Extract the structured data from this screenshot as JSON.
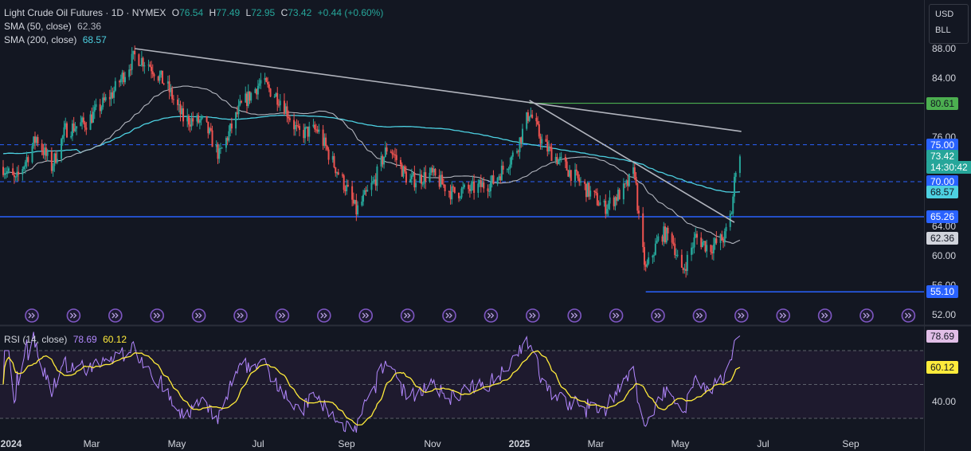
{
  "header": {
    "symbol": "Light Crude Oil Futures · 1D · NYMEX",
    "o_label": "O",
    "o_value": "76.54",
    "h_label": "H",
    "h_value": "77.49",
    "l_label": "L",
    "l_value": "72.95",
    "c_label": "C",
    "c_value": "73.42",
    "change": "+0.44 (+0.60%)",
    "sma50_label": "SMA (50, close)",
    "sma50_value": "62.36",
    "sma200_label": "SMA (200, close)",
    "sma200_value": "68.57",
    "rsi_label": "RSI (14, close)",
    "rsi_value": "78.69",
    "rsi_ma_value": "60.12"
  },
  "unit_box": {
    "currency": "USD",
    "unit": "BLL"
  },
  "price_tags": [
    {
      "text": "80.61",
      "price": 80.61,
      "bg": "#4caf50",
      "fg": "#131722"
    },
    {
      "text": "75.00",
      "price": 75.0,
      "bg": "#2962ff",
      "fg": "#ffffff"
    },
    {
      "text": "73.42",
      "price": 73.42,
      "bg": "#26a69a",
      "fg": "#ffffff"
    },
    {
      "text": "14:30:42",
      "price": 71.9,
      "bg": "#26a69a",
      "fg": "#ffffff"
    },
    {
      "text": "70.00",
      "price": 70.0,
      "bg": "#2962ff",
      "fg": "#ffffff"
    },
    {
      "text": "68.57",
      "price": 68.57,
      "bg": "#4dd0e1",
      "fg": "#131722"
    },
    {
      "text": "65.26",
      "price": 65.26,
      "bg": "#2962ff",
      "fg": "#ffffff"
    },
    {
      "text": "62.36",
      "price": 62.36,
      "bg": "#d1d4dc",
      "fg": "#131722"
    },
    {
      "text": "55.10",
      "price": 55.1,
      "bg": "#2962ff",
      "fg": "#ffffff"
    },
    {
      "text": "78.69",
      "rsi": 78.69,
      "bg": "#e1bee7",
      "fg": "#131722"
    },
    {
      "text": "60.12",
      "rsi": 60.12,
      "bg": "#ffeb3b",
      "fg": "#131722"
    }
  ],
  "y_axis_labels": [
    "88.00",
    "84.00",
    "76.00",
    "64.00",
    "60.00",
    "56.00",
    "52.00"
  ],
  "rsi_axis_label": "40.00",
  "x_axis_labels": [
    {
      "text": "2024",
      "bold": true
    },
    {
      "text": "Mar",
      "bold": false
    },
    {
      "text": "May",
      "bold": false
    },
    {
      "text": "Jul",
      "bold": false
    },
    {
      "text": "Sep",
      "bold": false
    },
    {
      "text": "Nov",
      "bold": false
    },
    {
      "text": "2025",
      "bold": true
    },
    {
      "text": "Mar",
      "bold": false
    },
    {
      "text": "May",
      "bold": false
    },
    {
      "text": "Jul",
      "bold": false
    },
    {
      "text": "Sep",
      "bold": false
    }
  ],
  "colors": {
    "up": "#26a69a",
    "down": "#ef5350",
    "sma50": "#b2b5be",
    "sma200": "#4dd0e1",
    "rsi": "#b388ff",
    "rsi_ma": "#ffeb3b",
    "hline": "#2962ff",
    "resistance": "#4caf50",
    "trendline": "#b2b5be",
    "event": "#7e57c2"
  },
  "chart_data": {
    "type": "candlestick",
    "title": "Light Crude Oil Futures · 1D · NYMEX",
    "ylim": [
      52,
      90
    ],
    "rsi_ylim": [
      20,
      90
    ],
    "anchors": [
      [
        "2024-01-01",
        72
      ],
      [
        "2024-01-10",
        70
      ],
      [
        "2024-01-25",
        76
      ],
      [
        "2024-02-05",
        72
      ],
      [
        "2024-02-15",
        77
      ],
      [
        "2024-03-01",
        78
      ],
      [
        "2024-03-20",
        82
      ],
      [
        "2024-04-05",
        87
      ],
      [
        "2024-04-15",
        86
      ],
      [
        "2024-04-28",
        83
      ],
      [
        "2024-05-10",
        78.5
      ],
      [
        "2024-05-25",
        78
      ],
      [
        "2024-06-05",
        73.5
      ],
      [
        "2024-06-20",
        80
      ],
      [
        "2024-07-05",
        83.5
      ],
      [
        "2024-07-20",
        81
      ],
      [
        "2024-08-01",
        76.5
      ],
      [
        "2024-08-15",
        77
      ],
      [
        "2024-08-25",
        73
      ],
      [
        "2024-09-05",
        69
      ],
      [
        "2024-09-12",
        66
      ],
      [
        "2024-09-25",
        70
      ],
      [
        "2024-10-05",
        75
      ],
      [
        "2024-10-20",
        70
      ],
      [
        "2024-11-05",
        71
      ],
      [
        "2024-11-20",
        68.5
      ],
      [
        "2024-12-05",
        69
      ],
      [
        "2024-12-20",
        70
      ],
      [
        "2025-01-05",
        74
      ],
      [
        "2025-01-15",
        79.5
      ],
      [
        "2025-01-25",
        75
      ],
      [
        "2025-02-10",
        72
      ],
      [
        "2025-02-25",
        69
      ],
      [
        "2025-03-10",
        66.5
      ],
      [
        "2025-03-25",
        69
      ],
      [
        "2025-04-01",
        71.5
      ],
      [
        "2025-04-05",
        62.5
      ],
      [
        "2025-04-09",
        58
      ],
      [
        "2025-04-20",
        63
      ],
      [
        "2025-04-28",
        62.5
      ],
      [
        "2025-05-05",
        57.5
      ],
      [
        "2025-05-15",
        62.5
      ],
      [
        "2025-05-25",
        61
      ],
      [
        "2025-06-05",
        62.5
      ],
      [
        "2025-06-10",
        66
      ],
      [
        "2025-06-13",
        72
      ],
      [
        "2025-06-16",
        73.42
      ]
    ],
    "levels": [
      80.61,
      75.0,
      70.0,
      65.26,
      55.1
    ],
    "trendlines": [
      {
        "from": [
          "2024-04-05",
          88.0
        ],
        "to": [
          "2025-06-17",
          76.8
        ]
      },
      {
        "from": [
          "2025-01-15",
          81.0
        ],
        "to": [
          "2025-06-12",
          64.5
        ]
      }
    ],
    "series": [
      {
        "name": "Light Crude Oil Futures",
        "last": 73.42
      },
      {
        "name": "SMA (50, close)",
        "last": 62.36
      },
      {
        "name": "SMA (200, close)",
        "last": 68.57
      },
      {
        "name": "RSI (14, close)",
        "last": 78.69
      },
      {
        "name": "RSI MA",
        "last": 60.12
      }
    ]
  }
}
